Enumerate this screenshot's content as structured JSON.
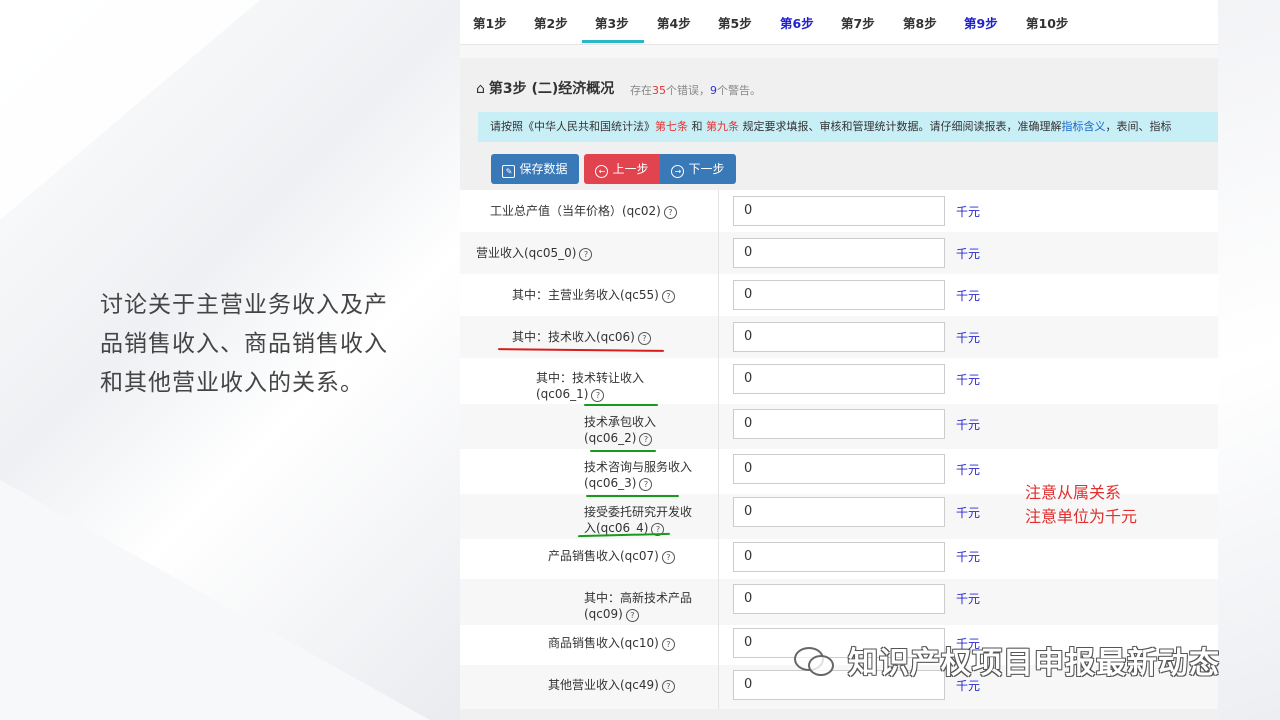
{
  "slide": {
    "side_text": "讨论关于主营业务收入及产品销售收入、商品销售收入和其他营业收入的关系。",
    "annotation_line1": "注意从属关系",
    "annotation_line2": "注意单位为千元",
    "watermark": "知识产权项目申报最新动态"
  },
  "tabs": [
    {
      "label": "第1步",
      "color": "#333333"
    },
    {
      "label": "第2步",
      "color": "#333333"
    },
    {
      "label": "第3步",
      "color": "#333333",
      "active": true
    },
    {
      "label": "第4步",
      "color": "#333333"
    },
    {
      "label": "第5步",
      "color": "#333333"
    },
    {
      "label": "第6步",
      "color": "#2222cc"
    },
    {
      "label": "第7步",
      "color": "#333333"
    },
    {
      "label": "第8步",
      "color": "#333333"
    },
    {
      "label": "第9步",
      "color": "#2222cc"
    },
    {
      "label": "第10步",
      "color": "#333333"
    }
  ],
  "header": {
    "title": "第3步 (二)经济概况",
    "err_prefix": "存在",
    "err_count": "35",
    "err_mid": "个错误，",
    "warn_count": "9",
    "warn_suffix": "个警告。"
  },
  "notice": {
    "t1": "请按照《中华人民共和国统计法》",
    "r1": "第七条",
    "t2": " 和 ",
    "r2": "第九条",
    "t3": " 规定要求填报、审核和管理统计数据。请仔细阅读报表，准确理解",
    "link": "指标含义",
    "t4": "，表间、指标"
  },
  "buttons": {
    "save": "保存数据",
    "prev": "上一步",
    "next": "下一步"
  },
  "help_glyph": "?",
  "fields": [
    {
      "label": "工业总产值（当年价格）(qc02)",
      "value": "0",
      "unit": "千元"
    },
    {
      "label": "营业收入(qc05_0)",
      "value": "0",
      "unit": "千元"
    },
    {
      "label": "其中：主营业务收入(qc55)",
      "value": "0",
      "unit": "千元"
    },
    {
      "label": "其中：技术收入(qc06)",
      "value": "0",
      "unit": "千元"
    },
    {
      "label": "其中：技术转让收入(qc06_1)",
      "value": "0",
      "unit": "千元"
    },
    {
      "label": "技术承包收入(qc06_2)",
      "value": "0",
      "unit": "千元"
    },
    {
      "label": "技术咨询与服务收入(qc06_3)",
      "value": "0",
      "unit": "千元"
    },
    {
      "label": "接受委托研究开发收入(qc06_4)",
      "value": "0",
      "unit": "千元"
    },
    {
      "label": "产品销售收入(qc07)",
      "value": "0",
      "unit": "千元"
    },
    {
      "label": "其中：高新技术产品(qc09)",
      "value": "0",
      "unit": "千元"
    },
    {
      "label": "商品销售收入(qc10)",
      "value": "0",
      "unit": "千元"
    },
    {
      "label": "其他营业收入(qc49)",
      "value": "0",
      "unit": "千元"
    }
  ]
}
